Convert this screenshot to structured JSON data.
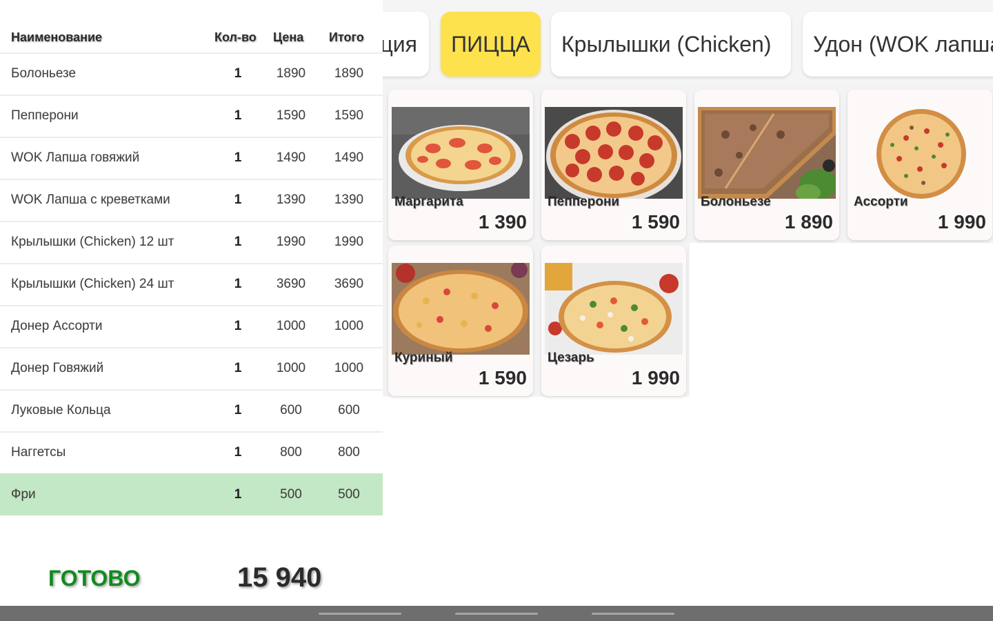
{
  "order": {
    "headers": {
      "name": "Наименование",
      "qty": "Кол-во",
      "price": "Цена",
      "total": "Итого"
    },
    "rows": [
      {
        "name": "Болоньезе",
        "qty": "1",
        "price": "1890",
        "total": "1890"
      },
      {
        "name": "Пепперони",
        "qty": "1",
        "price": "1590",
        "total": "1590"
      },
      {
        "name": "WOK Лапша говяжий",
        "qty": "1",
        "price": "1490",
        "total": "1490"
      },
      {
        "name": "WOK Лапша с креветками",
        "qty": "1",
        "price": "1390",
        "total": "1390"
      },
      {
        "name": "Крылышки (Chicken) 12 шт",
        "qty": "1",
        "price": "1990",
        "total": "1990"
      },
      {
        "name": "Крылышки (Chicken) 24 шт",
        "qty": "1",
        "price": "3690",
        "total": "3690"
      },
      {
        "name": "Донер Ассорти",
        "qty": "1",
        "price": "1000",
        "total": "1000"
      },
      {
        "name": "Донер Говяжий",
        "qty": "1",
        "price": "1000",
        "total": "1000"
      },
      {
        "name": "Луковые Кольца",
        "qty": "1",
        "price": "600",
        "total": "600"
      },
      {
        "name": "Наггетсы",
        "qty": "1",
        "price": "800",
        "total": "800"
      },
      {
        "name": "Фри",
        "qty": "1",
        "price": "500",
        "total": "500"
      }
    ],
    "done_label": "ГОТОВО",
    "grand_total": "15 940"
  },
  "categories": [
    {
      "label": "ция"
    },
    {
      "label": "ПИЦЦА"
    },
    {
      "label": "Крылышки (Chicken)"
    },
    {
      "label": "Удон (WOK лапша"
    }
  ],
  "products": [
    {
      "name": "Маргарита",
      "price": "1 390"
    },
    {
      "name": "Пепперони",
      "price": "1 590"
    },
    {
      "name": "Болоньезе",
      "price": "1 890"
    },
    {
      "name": "Ассорти",
      "price": "1 990"
    },
    {
      "name": "Куриный",
      "price": "1 590"
    },
    {
      "name": "Цезарь",
      "price": "1 990"
    }
  ],
  "colors": {
    "selected_category": "#fde24d",
    "selected_row": "#c3e8c6",
    "done_button": "#138a1e",
    "navbar": "#6e6e6e"
  }
}
